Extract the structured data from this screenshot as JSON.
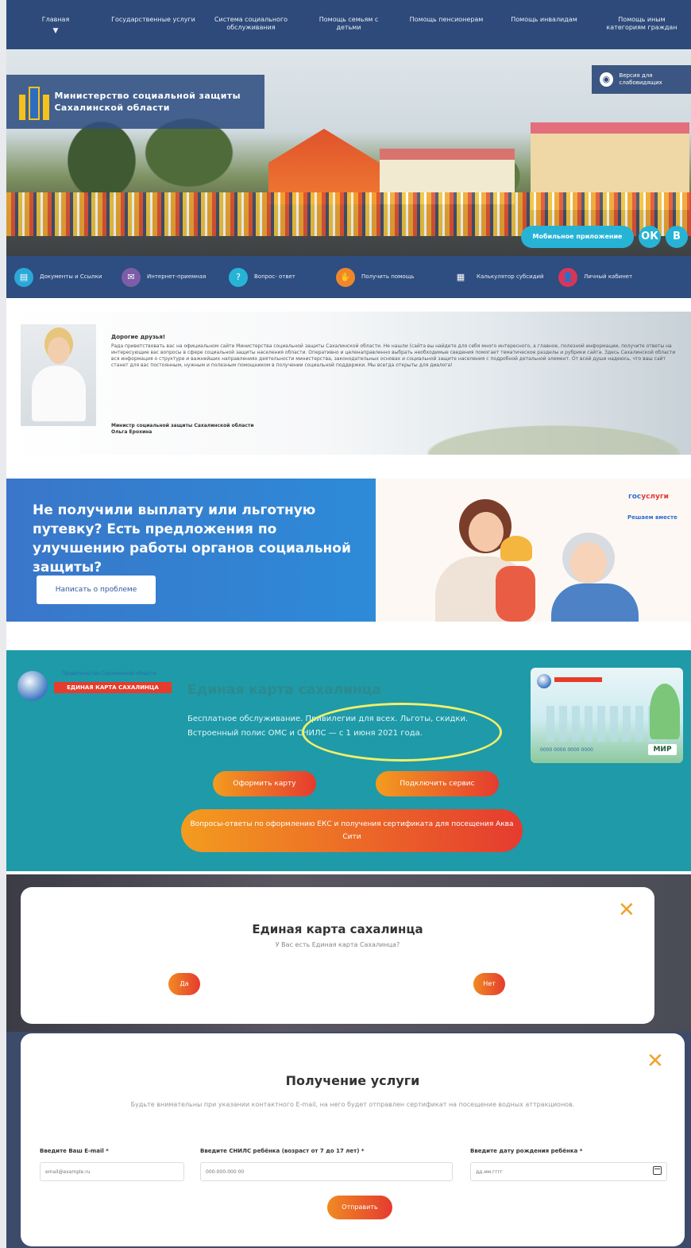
{
  "nav": {
    "items": [
      {
        "label": "Главная",
        "caret": "▼"
      },
      {
        "label": "Государственные услуги"
      },
      {
        "label": "Система социального обслуживания"
      },
      {
        "label": "Помощь семьям с детьми"
      },
      {
        "label": "Помощь пенсионерам"
      },
      {
        "label": "Помощь инвалидам"
      },
      {
        "label": "Помощь иным категориям граждан"
      }
    ]
  },
  "header": {
    "logo_text": "Министерство социальной защиты Сахалинской области",
    "vision_label": "Версия для слабовидящих",
    "mobile_label": "Мобильное приложение",
    "ok_label": "ОК",
    "vk_label": "В"
  },
  "quick_links": [
    {
      "label": "Документы и Ссылки",
      "color": "#2aa8d8",
      "icon": "document-icon",
      "glyph": "▤"
    },
    {
      "label": "Интернет-приемная",
      "color": "#7b5ea7",
      "icon": "chat-icon",
      "glyph": "✉"
    },
    {
      "label": "Вопрос- ответ",
      "color": "#27b3d6",
      "icon": "question-icon",
      "glyph": "?"
    },
    {
      "label": "Получить помощь",
      "color": "#f0862a",
      "icon": "help-icon",
      "glyph": "✋"
    },
    {
      "label": "Калькулятор субсидий",
      "color": "#2e4d80",
      "icon": "calculator-icon",
      "glyph": "▦"
    },
    {
      "label": "Личный кабинет",
      "color": "#d6365a",
      "icon": "user-icon",
      "glyph": "👤"
    }
  ],
  "greeting": {
    "title": "Дорогие друзья!",
    "text": "Рада приветствовать вас на официальном сайте Министерства социальной защиты Сахалинской области. Не нашли (сайта вы найдете для себя много интересного, а главное, полезной информации, получите ответы на интересующие вас вопросы в сфере социальной защиты населения области. Оперативно и целенаправленно выбрать необходимые сведения помогает тематическое разделы и рубрики сайта. Здесь Сахалинской области вся информация о структуре и важнейших направлениях деятельности министерства, законодательных основах и социальной защите населения с подробной детальной элемент. От всей души надеюсь, что ваш сайт станет для вас постоянным, нужным и полезным помощником в получении социальной поддержки. Мы всегда открыты для диалога!",
    "signature_line1": "Министр социальной защиты Сахалинской области",
    "signature_line2": "Ольга Ерохина"
  },
  "complaint": {
    "headline": "Не получили выплату или льготную путевку? Есть предложения по улучшению работы органов социальной защиты?",
    "button": "Написать о проблеме",
    "gos_prefix": "гос",
    "gos_suffix": "услуги",
    "gos_sub": "Решаем вместе"
  },
  "card_section": {
    "small_label": "Правительство Сахалинской области",
    "badge": "ЕДИНАЯ КАРТА САХАЛИНЦА",
    "title": "Единая карта сахалинца",
    "description": "Бесплатное обслуживание. Привилегии для всех. Льготы, скидки. Встроенный полис ОМС и СНИЛС — с 1 июня 2021 года.",
    "btn_card": "Оформить карту",
    "btn_connect": "Подключить сервис",
    "btn_faq": "Вопросы-ответы по оформлению ЕКС и получения сертификата для посещения Аква Сити",
    "card_mir": "МИР",
    "card_number": "0000 0000 0000 0000",
    "ellipse_color": "#f2ef6a"
  },
  "modal1": {
    "close": "✕",
    "title": "Единая карта сахалинца",
    "question": "У Вас есть Единая карта Сахалинца?",
    "yes": "Да",
    "no": "Нет"
  },
  "modal2": {
    "close": "✕",
    "title": "Получение услуги",
    "note": "Будьте внимательны при указании контактного E-mail, на него будет отправлен сертификат на посещение водных аттракционов.",
    "email_label": "Введите Ваш E-mail *",
    "email_placeholder": "email@example.ru",
    "snils_label": "Введите СНИЛС ребёнка (возраст от 7 до 17 лет) *",
    "snils_placeholder": "000-000-000 00",
    "date_label": "Введите дату рождения ребёнка *",
    "date_placeholder": "дд.мм.гггг",
    "submit": "Отправить"
  },
  "colors": {
    "nav_bg": "#2e4a7a",
    "accent_blue": "#27b3d6",
    "teal": "#1e9aa8",
    "orange": "#f08a24",
    "red": "#e53b2f"
  }
}
